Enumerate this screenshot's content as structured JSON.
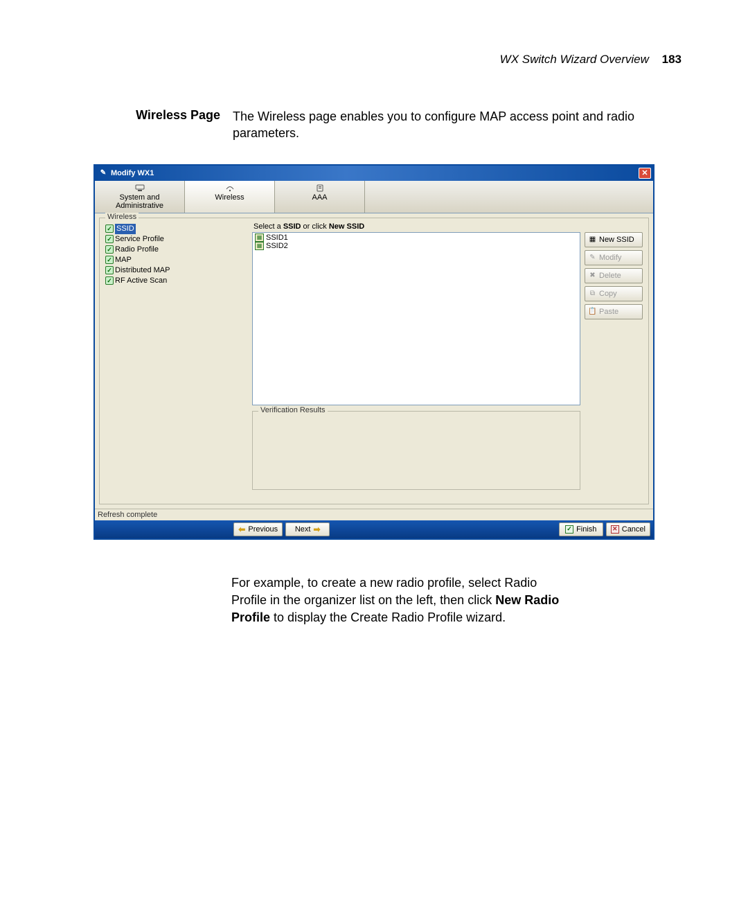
{
  "page_header": {
    "title": "WX Switch Wizard Overview",
    "page_number": "183"
  },
  "intro": {
    "heading": "Wireless Page",
    "text": "The Wireless page enables you to configure MAP access point and radio parameters."
  },
  "dialog": {
    "title": "Modify WX1",
    "tabs": [
      {
        "label": "System and Administrative",
        "icon": "system-icon"
      },
      {
        "label": "Wireless",
        "icon": "wireless-icon"
      },
      {
        "label": "AAA",
        "icon": "aaa-icon"
      }
    ],
    "selected_tab": 1,
    "fieldset_label": "Wireless",
    "tree": [
      {
        "label": "SSID",
        "selected": true
      },
      {
        "label": "Service Profile",
        "selected": false
      },
      {
        "label": "Radio Profile",
        "selected": false
      },
      {
        "label": "MAP",
        "selected": false
      },
      {
        "label": "Distributed MAP",
        "selected": false
      },
      {
        "label": "RF Active Scan",
        "selected": false
      }
    ],
    "select_prefix": "Select a ",
    "select_bold1": "SSID",
    "select_mid": " or click ",
    "select_bold2": "New SSID",
    "ssids": [
      {
        "label": "SSID1"
      },
      {
        "label": "SSID2"
      }
    ],
    "verification_label": "Verification Results",
    "buttons": {
      "new_ssid": "New SSID",
      "modify": "Modify",
      "delete": "Delete",
      "copy": "Copy",
      "paste": "Paste"
    },
    "status_text": "Refresh complete",
    "footer": {
      "previous": "Previous",
      "next": "Next",
      "finish": "Finish",
      "cancel": "Cancel"
    }
  },
  "outro": {
    "p1a": "For example, to create a new radio profile, select Radio Profile in the organizer list on the left, then click ",
    "p1b": "New Radio Profile",
    "p1c": " to display the Create Radio Profile wizard."
  }
}
